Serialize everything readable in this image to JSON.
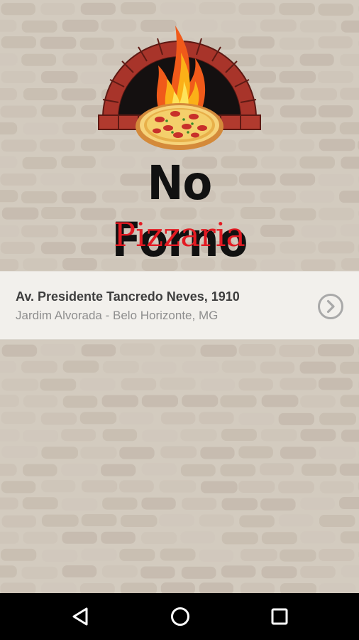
{
  "app": {
    "brand_name": "No Forno",
    "brand_subtitle": "Pizzaria"
  },
  "address": {
    "street": "Av. Presidente Tancredo Neves, 1910",
    "city": "Jardim Alvorada - Belo Horizonte, MG",
    "action_icon": "chevron-right-circle-icon"
  },
  "navigation_bar": {
    "buttons": [
      {
        "icon": "back-triangle-icon"
      },
      {
        "icon": "home-circle-icon"
      },
      {
        "icon": "recents-square-icon"
      }
    ]
  },
  "colors": {
    "background": "#d3cbbf",
    "brand_name": "#111111",
    "brand_subtitle": "#e31b23",
    "card_background": "#f2f0ec",
    "street_text": "#3e3e3e",
    "city_text": "#8e8e8e",
    "nav_bar": "#000000"
  }
}
